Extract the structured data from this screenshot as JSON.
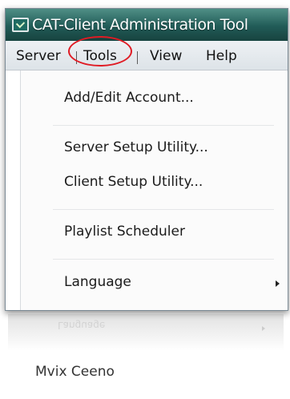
{
  "window": {
    "title": "CAT-Client Administration Tool",
    "icon": "app-window-icon"
  },
  "menubar": {
    "items": [
      "Server",
      "Tools",
      "View",
      "Help"
    ],
    "active": "Tools"
  },
  "dropdown": {
    "items": [
      {
        "label": "Add/Edit Account...",
        "has_submenu": false
      },
      {
        "label": "Server Setup Utility...",
        "has_submenu": false
      },
      {
        "label": "Client Setup Utility...",
        "has_submenu": false
      },
      {
        "label": "Playlist Scheduler",
        "has_submenu": false
      },
      {
        "label": "Language",
        "has_submenu": true
      }
    ]
  },
  "reflection_text": "Language",
  "caption": "Mvix Ceeno",
  "colors": {
    "titlebar": "#215b57",
    "highlight": "#e01b24"
  }
}
